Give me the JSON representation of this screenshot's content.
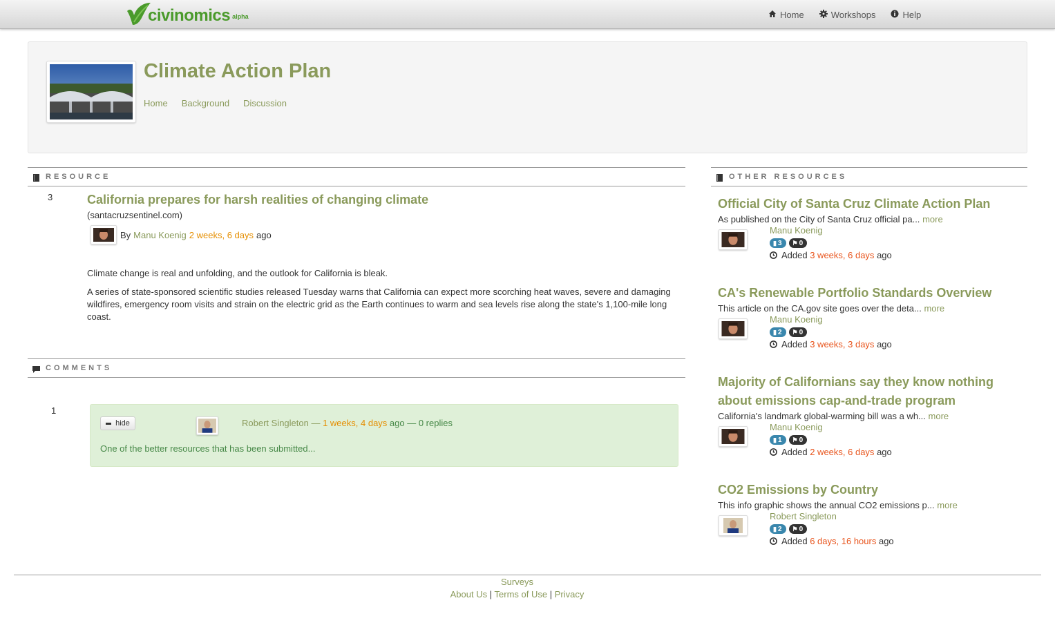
{
  "navbar": {
    "logo_text": "civinomics",
    "logo_badge": "alpha",
    "links": [
      {
        "label": "Home",
        "icon": "home-icon"
      },
      {
        "label": "Workshops",
        "icon": "gear-icon"
      },
      {
        "label": "Help",
        "icon": "info-icon"
      }
    ]
  },
  "workshop": {
    "title": "Climate Action Plan",
    "tabs": [
      "Home",
      "Background",
      "Discussion"
    ]
  },
  "resource_section": {
    "heading": "RESOURCE",
    "vote_count": "3",
    "title": "California prepares for harsh realities of changing climate",
    "domain": "(santacruzsentinel.com)",
    "by": "By",
    "author": "Manu Koenig",
    "time": "2 weeks, 6 days",
    "ago": "ago",
    "paragraph1": "Climate change is real and unfolding, and the outlook for California is bleak.",
    "paragraph2": "A series of state-sponsored scientific studies released Tuesday warns that California can expect more scorching heat waves, severe and damaging wildfires, emergency room visits and strain on the electric grid as the Earth continues to warm and sea levels rise along the state's 1,100-mile long coast."
  },
  "comments_section": {
    "heading": "COMMENTS",
    "vote_count": "1",
    "hide_label": "hide",
    "author": "Robert Singleton",
    "sep1": " — ",
    "time": "1 weeks, 4 days",
    "ago": " ago",
    "sep2": " — ",
    "replies": "0 replies",
    "text": "One of the better resources that has been submitted..."
  },
  "sidebar": {
    "heading": "OTHER RESOURCES",
    "more_label": "more",
    "added_label": "Added",
    "ago_label": "ago",
    "items": [
      {
        "title": "Official City of Santa Cruz Climate Action Plan",
        "desc": "As published on the City of Santa Cruz official pa...",
        "author": "Manu Koenig",
        "comments": "3",
        "flags": "0",
        "time": "3 weeks, 6 days"
      },
      {
        "title": "CA's Renewable Portfolio Standards Overview",
        "desc": "This article on the CA.gov site goes over the deta...",
        "author": "Manu Koenig",
        "comments": "2",
        "flags": "0",
        "time": "3 weeks, 3 days"
      },
      {
        "title": "Majority of Californians say they know nothing about emissions cap-and-trade program",
        "desc": "California's landmark global-warming bill was a wh...",
        "author": "Manu Koenig",
        "comments": "1",
        "flags": "0",
        "time": "2 weeks, 6 days"
      },
      {
        "title": "CO2 Emissions by Country",
        "desc": "This info graphic shows the annual CO2 emissions p...",
        "author": "Robert Singleton",
        "comments": "2",
        "flags": "0",
        "time": "6 days, 16 hours"
      }
    ]
  },
  "footer": {
    "surveys": "Surveys",
    "about": "About Us",
    "terms": "Terms of Use",
    "privacy": "Privacy",
    "separator": "|"
  },
  "colors": {
    "accent_green": "#8a9a5b",
    "logo_green": "#4a9a2b",
    "time_orange": "#e58e00",
    "time_red": "#e8541c",
    "comment_bg": "#dff0d8"
  }
}
